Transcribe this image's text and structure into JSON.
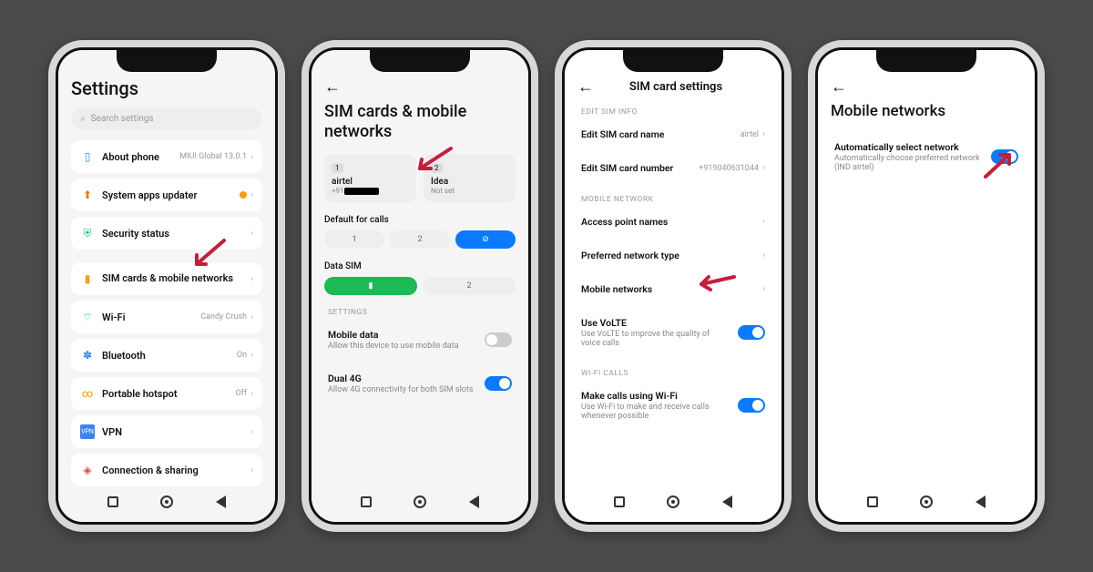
{
  "p1": {
    "title": "Settings",
    "search_ph": "Search settings",
    "about": "About phone",
    "about_sub": "MIUI Global 13.0.1",
    "updater": "System apps updater",
    "security": "Security status",
    "sim": "SIM cards & mobile networks",
    "wifi": "Wi-Fi",
    "wifi_val": "Candy Crush",
    "bt": "Bluetooth",
    "bt_val": "On",
    "hotspot": "Portable hotspot",
    "hotspot_val": "Off",
    "vpn": "VPN",
    "conn": "Connection & sharing"
  },
  "p2": {
    "title": "SIM cards & mobile networks",
    "sim1": "airtel",
    "sim1_sub": "+91",
    "sim2": "Idea",
    "sim2_sub": "Not set",
    "default_calls": "Default for calls",
    "data_sim": "Data SIM",
    "settings_label": "SETTINGS",
    "mobile_data": "Mobile data",
    "mobile_data_sub": "Allow this device to use mobile data",
    "dual4g": "Dual 4G",
    "dual4g_sub": "Allow 4G connectivity for both SIM slots"
  },
  "p3": {
    "title": "SIM card settings",
    "edit_info": "EDIT SIM INFO",
    "edit_name": "Edit SIM card name",
    "edit_name_val": "airtel",
    "edit_num": "Edit SIM card number",
    "edit_num_val": "+919040631044",
    "mnet": "MOBILE NETWORK",
    "apn": "Access point names",
    "pref": "Preferred network type",
    "mobnet": "Mobile networks",
    "volte": "Use VoLTE",
    "volte_sub": "Use VoLTE to improve the quality of voice calls",
    "wifi_calls": "WI-FI CALLS",
    "make_wifi": "Make calls using Wi-Fi",
    "make_wifi_sub": "Use Wi-Fi to make and receive calls whenever possible"
  },
  "p4": {
    "title": "Mobile networks",
    "auto": "Automatically select network",
    "auto_sub": "Automatically choose preferred network (IND airtel)"
  }
}
